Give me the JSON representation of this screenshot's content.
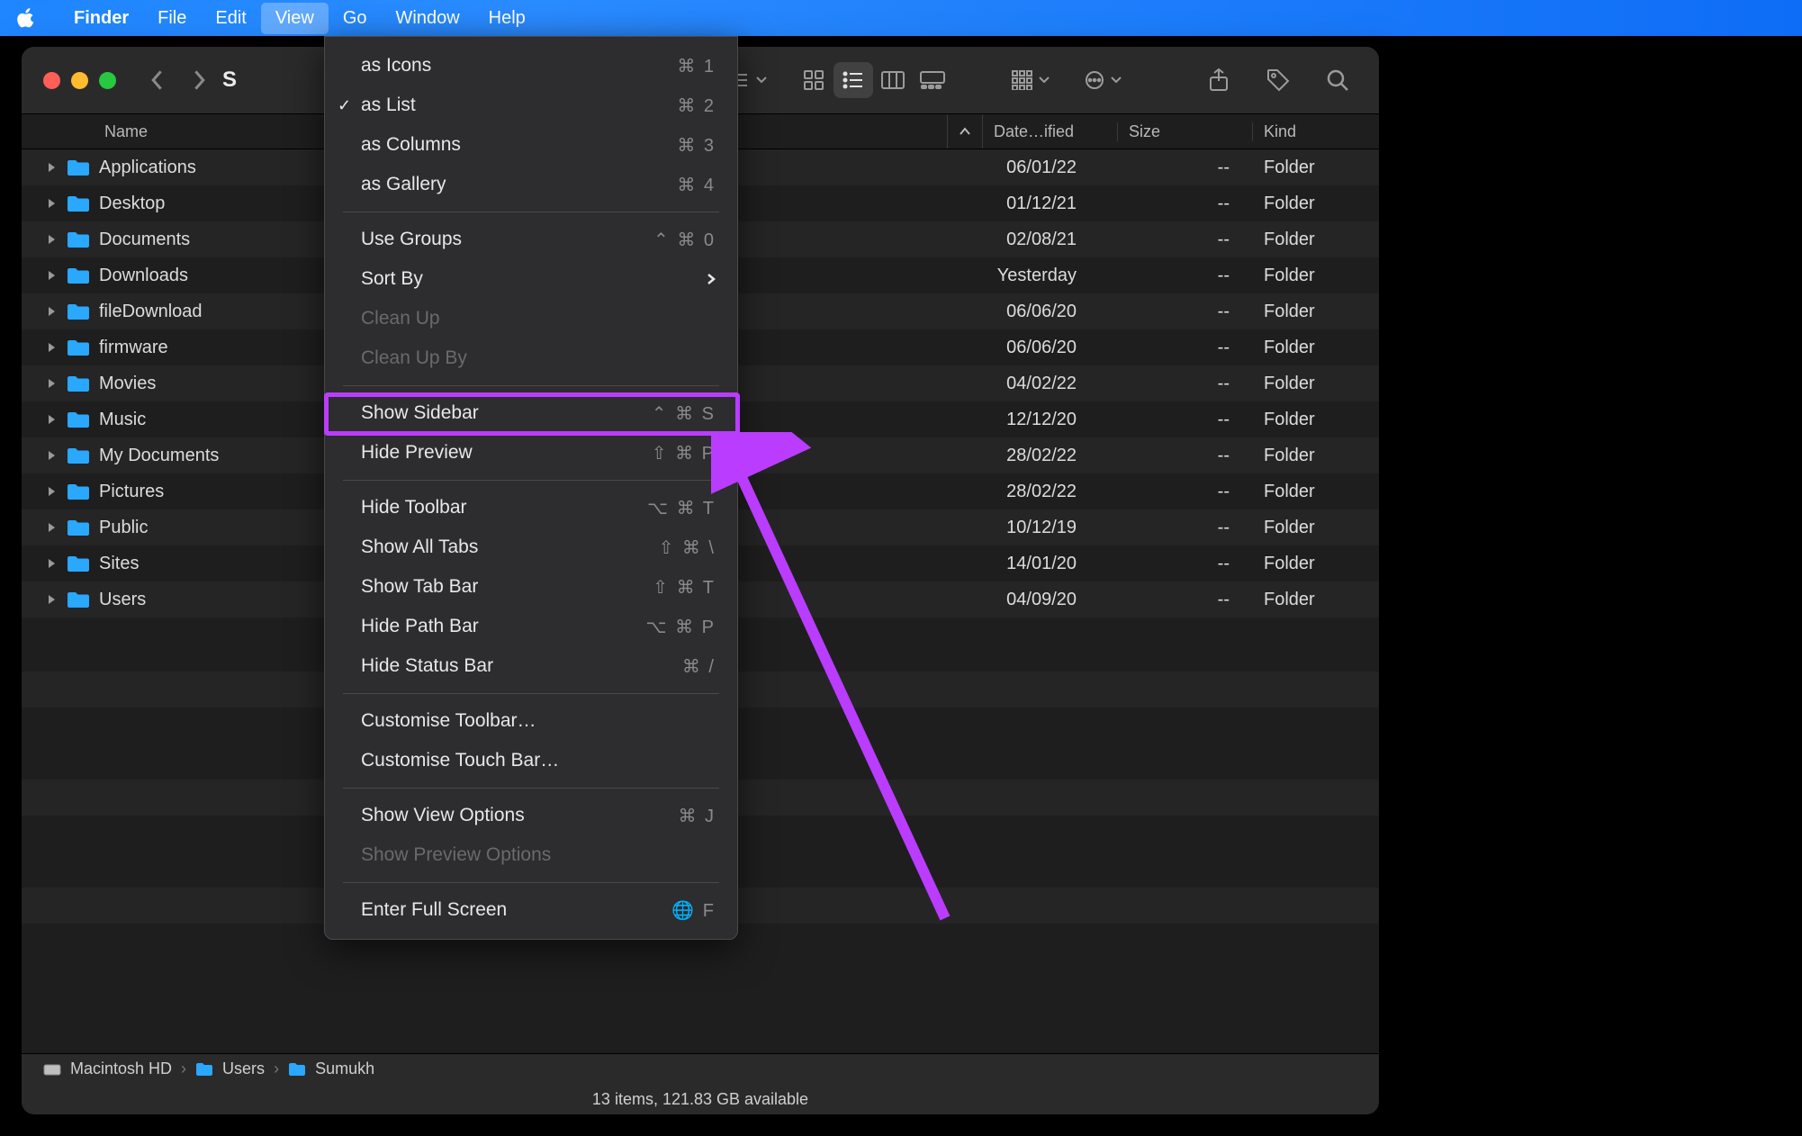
{
  "menubar": {
    "app": "Finder",
    "items": [
      "File",
      "Edit",
      "View",
      "Go",
      "Window",
      "Help"
    ],
    "active_index": 2
  },
  "toolbar": {
    "title_cut": "S"
  },
  "columns": {
    "name": "Name",
    "date": "Date…ified",
    "size": "Size",
    "kind": "Kind"
  },
  "rows": [
    {
      "name": "Applications",
      "date": "06/01/22",
      "size": "--",
      "kind": "Folder"
    },
    {
      "name": "Desktop",
      "date": "01/12/21",
      "size": "--",
      "kind": "Folder"
    },
    {
      "name": "Documents",
      "date": "02/08/21",
      "size": "--",
      "kind": "Folder"
    },
    {
      "name": "Downloads",
      "date": "Yesterday",
      "size": "--",
      "kind": "Folder"
    },
    {
      "name": "fileDownload",
      "date": "06/06/20",
      "size": "--",
      "kind": "Folder"
    },
    {
      "name": "firmware",
      "date": "06/06/20",
      "size": "--",
      "kind": "Folder"
    },
    {
      "name": "Movies",
      "date": "04/02/22",
      "size": "--",
      "kind": "Folder"
    },
    {
      "name": "Music",
      "date": "12/12/20",
      "size": "--",
      "kind": "Folder"
    },
    {
      "name": "My Documents",
      "date": "28/02/22",
      "size": "--",
      "kind": "Folder"
    },
    {
      "name": "Pictures",
      "date": "28/02/22",
      "size": "--",
      "kind": "Folder"
    },
    {
      "name": "Public",
      "date": "10/12/19",
      "size": "--",
      "kind": "Folder"
    },
    {
      "name": "Sites",
      "date": "14/01/20",
      "size": "--",
      "kind": "Folder"
    },
    {
      "name": "Users",
      "date": "04/09/20",
      "size": "--",
      "kind": "Folder"
    }
  ],
  "empty_stripes": 6,
  "pathbar": {
    "segments": [
      "Macintosh HD",
      "Users",
      "Sumukh"
    ]
  },
  "status": "13 items, 121.83 GB available",
  "dropdown": {
    "sections": [
      [
        {
          "label": "as Icons",
          "shortcut": "⌘ 1"
        },
        {
          "label": "as List",
          "shortcut": "⌘ 2",
          "checked": true
        },
        {
          "label": "as Columns",
          "shortcut": "⌘ 3"
        },
        {
          "label": "as Gallery",
          "shortcut": "⌘ 4"
        }
      ],
      [
        {
          "label": "Use Groups",
          "shortcut": "⌃ ⌘ 0"
        },
        {
          "label": "Sort By",
          "submenu": true
        },
        {
          "label": "Clean Up",
          "disabled": true
        },
        {
          "label": "Clean Up By",
          "disabled": true
        }
      ],
      [
        {
          "label": "Show Sidebar",
          "shortcut": "⌃ ⌘ S",
          "highlighted": true
        },
        {
          "label": "Hide Preview",
          "shortcut": "⇧ ⌘ P"
        }
      ],
      [
        {
          "label": "Hide Toolbar",
          "shortcut": "⌥ ⌘ T"
        },
        {
          "label": "Show All Tabs",
          "shortcut": "⇧ ⌘ \\"
        },
        {
          "label": "Show Tab Bar",
          "shortcut": "⇧ ⌘ T"
        },
        {
          "label": "Hide Path Bar",
          "shortcut": "⌥ ⌘ P"
        },
        {
          "label": "Hide Status Bar",
          "shortcut": "⌘ /"
        }
      ],
      [
        {
          "label": "Customise Toolbar…"
        },
        {
          "label": "Customise Touch Bar…"
        }
      ],
      [
        {
          "label": "Show View Options",
          "shortcut": "⌘ J"
        },
        {
          "label": "Show Preview Options",
          "disabled": true
        }
      ],
      [
        {
          "label": "Enter Full Screen",
          "shortcut": "🌐 F"
        }
      ]
    ]
  }
}
